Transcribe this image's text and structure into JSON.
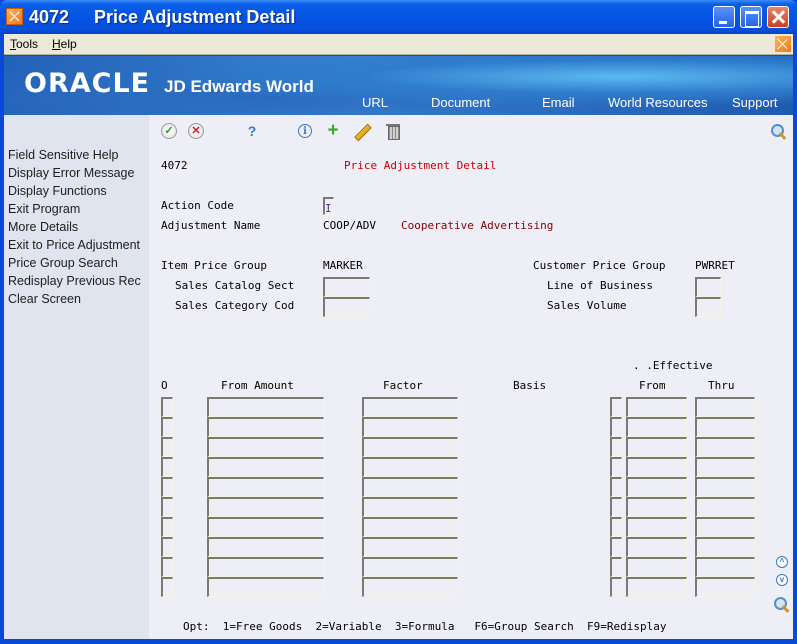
{
  "window": {
    "program_code": "4072",
    "title": "Price Adjustment Detail"
  },
  "menubar": {
    "tools": {
      "accel": "T",
      "rest": "ools"
    },
    "help": {
      "accel": "H",
      "rest": "elp"
    }
  },
  "banner": {
    "brand": "ORACLE",
    "product": "JD Edwards World",
    "links": [
      "URL",
      "Document",
      "Email",
      "World Resources",
      "Support"
    ]
  },
  "sidebar": {
    "items": [
      "Field Sensitive Help",
      "Display Error Message",
      "Display Functions",
      "Exit Program",
      "More Details",
      "Exit to Price Adjustment",
      "Price Group Search",
      "Redisplay Previous Rec",
      "Clear Screen"
    ]
  },
  "toolbar": {
    "icons": [
      "ok-icon",
      "cancel-icon",
      "help-icon",
      "info-icon",
      "add-icon",
      "edit-icon",
      "delete-icon",
      "search-icon"
    ]
  },
  "form": {
    "program_code": "4072",
    "form_title": "Price Adjustment Detail",
    "action_code_label": "Action Code",
    "action_code_value": "I",
    "adjustment_name_label": "Adjustment Name",
    "adjustment_name_value": "COOP/ADV",
    "adjustment_description": "Cooperative Advertising",
    "item_price_group_label": "Item Price Group",
    "item_price_group_value": "MARKER",
    "sales_catalog_label": "Sales Catalog Sect",
    "sales_catalog_value": "",
    "sales_category_label": "Sales Category Cod",
    "sales_category_value": "",
    "customer_price_group_label": "Customer Price Group",
    "customer_price_group_value": "PWRRET",
    "line_of_business_label": "Line of Business",
    "line_of_business_value": "",
    "sales_volume_label": "Sales Volume",
    "sales_volume_value": ""
  },
  "grid": {
    "effective_header": ". .Effective",
    "columns": {
      "option": "O",
      "from_amount": "From Amount",
      "factor": "Factor",
      "basis": "Basis",
      "from": "From",
      "thru": "Thru"
    },
    "row_count": 10,
    "rows": [
      {
        "option": "",
        "from_amount": "",
        "factor": "",
        "basis": "",
        "from": "",
        "thru": ""
      },
      {
        "option": "",
        "from_amount": "",
        "factor": "",
        "basis": "",
        "from": "",
        "thru": ""
      },
      {
        "option": "",
        "from_amount": "",
        "factor": "",
        "basis": "",
        "from": "",
        "thru": ""
      },
      {
        "option": "",
        "from_amount": "",
        "factor": "",
        "basis": "",
        "from": "",
        "thru": ""
      },
      {
        "option": "",
        "from_amount": "",
        "factor": "",
        "basis": "",
        "from": "",
        "thru": ""
      },
      {
        "option": "",
        "from_amount": "",
        "factor": "",
        "basis": "",
        "from": "",
        "thru": ""
      },
      {
        "option": "",
        "from_amount": "",
        "factor": "",
        "basis": "",
        "from": "",
        "thru": ""
      },
      {
        "option": "",
        "from_amount": "",
        "factor": "",
        "basis": "",
        "from": "",
        "thru": ""
      },
      {
        "option": "",
        "from_amount": "",
        "factor": "",
        "basis": "",
        "from": "",
        "thru": ""
      },
      {
        "option": "",
        "from_amount": "",
        "factor": "",
        "basis": "",
        "from": "",
        "thru": ""
      }
    ]
  },
  "footer": {
    "options_line": "Opt:  1=Free Goods  2=Variable  3=Formula   F6=Group Search  F9=Redisplay"
  },
  "colors": {
    "titlebar": "#0554e3",
    "main_bg": "#eeeef7",
    "sidebar_bg": "#dfe4ee",
    "title_red": "#cc0000",
    "description_red": "#8a0000"
  }
}
